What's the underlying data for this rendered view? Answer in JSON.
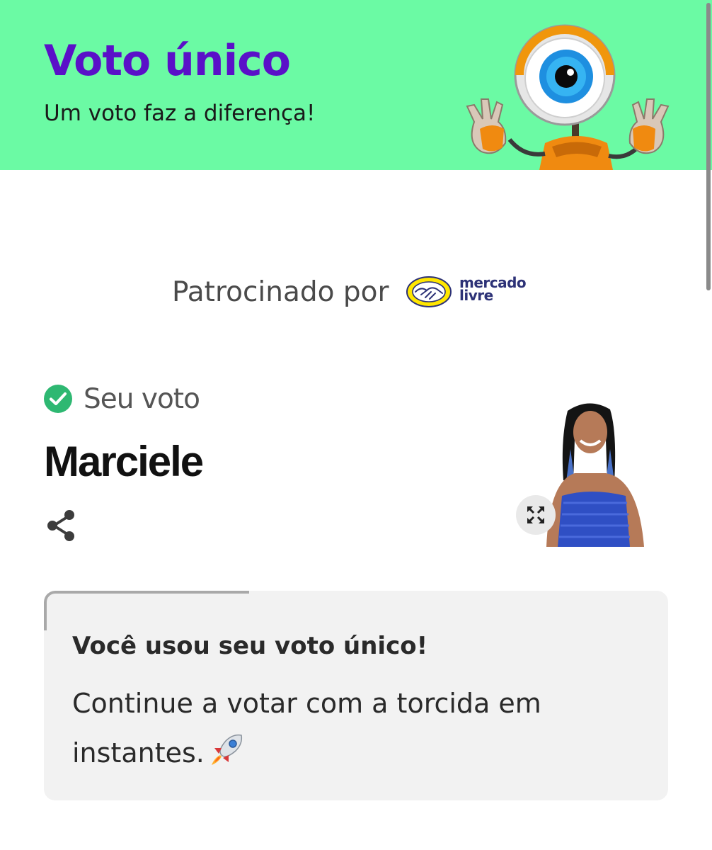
{
  "banner": {
    "title": "Voto único",
    "subtitle": "Um voto faz a diferença!",
    "bg_color": "#6bfaa4",
    "title_color": "#5a10c8",
    "mascot_icon": "big-brother-eye-robot"
  },
  "sponsor": {
    "label": "Patrocinado por",
    "logo_line1": "mercado",
    "logo_line2": "livre",
    "logo_color": "#ffe600"
  },
  "vote": {
    "status_label": "Seu voto",
    "candidate_name": "Marciele",
    "status_icon": "check-circle-icon",
    "share_icon": "share-icon",
    "expand_icon": "expand-icon"
  },
  "card": {
    "title": "Você usou seu voto único!",
    "body": "Continue a votar com a torcida em instantes.",
    "emoji_icon": "rocket-icon"
  }
}
